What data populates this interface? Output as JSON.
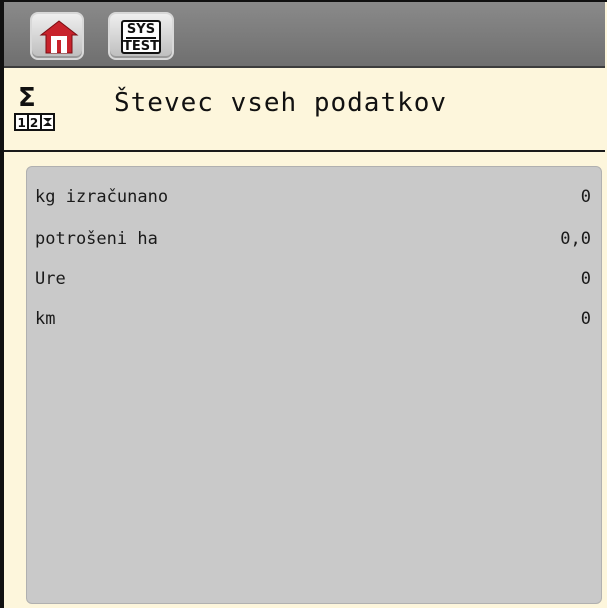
{
  "toolbar": {
    "home_icon": "home-icon",
    "sys_test": {
      "line1": "SYS",
      "line2": "TEST"
    }
  },
  "header": {
    "icon": "counter-sigma-icon",
    "sigma": "Σ",
    "digits": "12",
    "title": "Števec vseh podatkov"
  },
  "counters": [
    {
      "label": "kg izračunano",
      "value": "0"
    },
    {
      "label": "potrošeni ha",
      "value": "0,0"
    },
    {
      "label": "Ure",
      "value": "0"
    },
    {
      "label": "km",
      "value": "0"
    }
  ],
  "colors": {
    "toolbar_bg": "#7d7d7d",
    "header_bg": "#fdf6dc",
    "panel_bg": "#c9c9c9",
    "home_red": "#c8232c"
  }
}
